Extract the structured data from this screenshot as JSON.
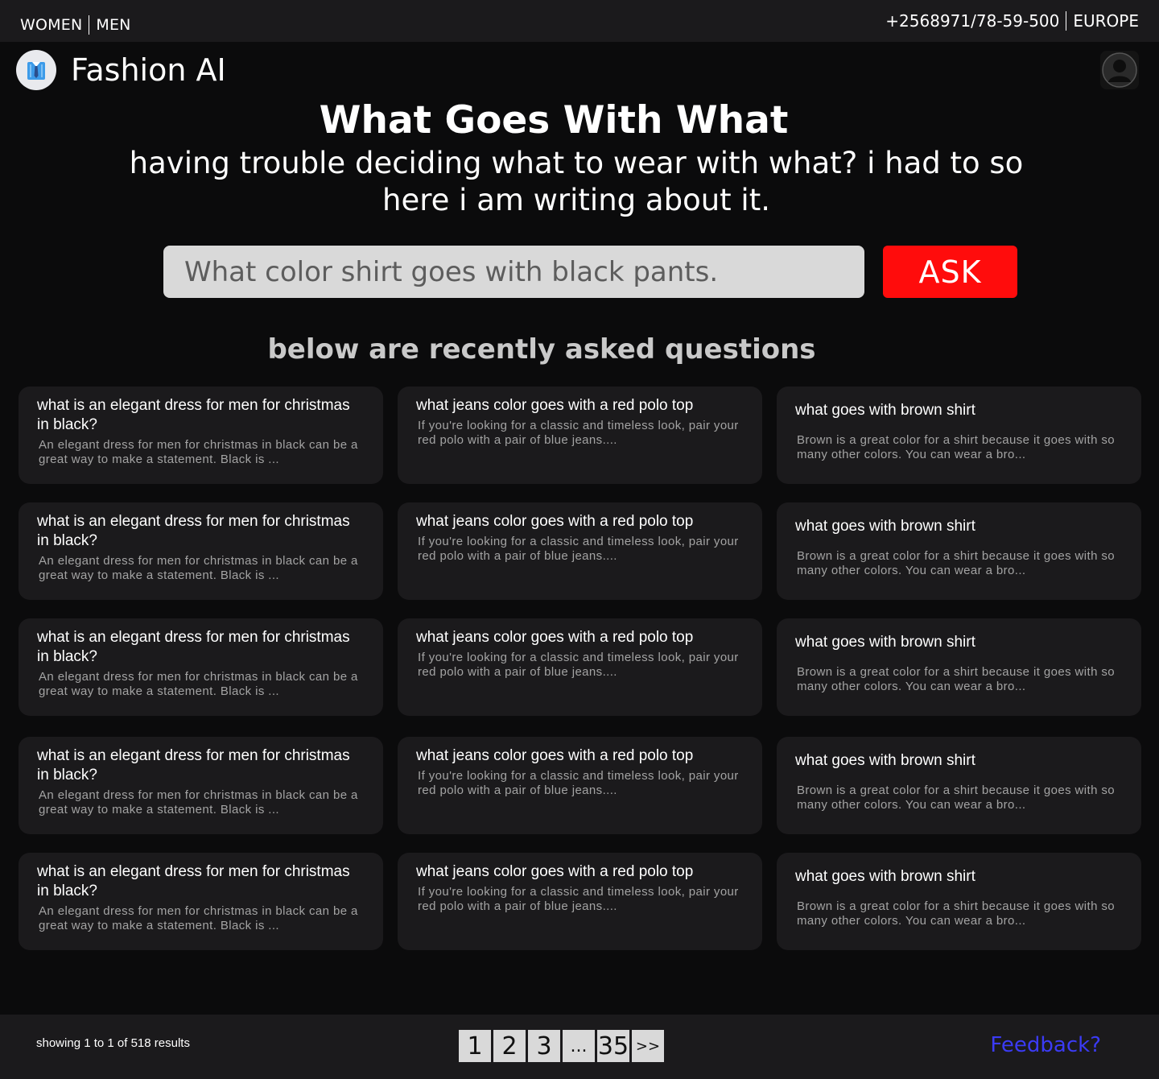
{
  "topbar": {
    "women": "WOMEN",
    "men": "MEN",
    "phone": "+2568971/78-59-500",
    "region": "EUROPE"
  },
  "header": {
    "brand": "Fashion AI",
    "logo_icon": "shirt-tie-icon",
    "profile_icon": "user-silhouette-icon"
  },
  "hero": {
    "title": "What Goes With What",
    "subtitle": "having trouble deciding what to wear with what? i had to so here i am writing about it."
  },
  "search": {
    "placeholder": "What color shirt goes with black pants.",
    "value": "",
    "ask_label": "ASK"
  },
  "recent": {
    "heading": "below are recently asked questions",
    "rows": [
      [
        {
          "question": "what is an elegant dress for men for christmas in black?",
          "answer": "An elegant dress for men for christmas in black can be a great way to make a statement. Black is ..."
        },
        {
          "question": "what jeans color goes with a red polo top",
          "answer": "If you're looking for a classic and timeless look, pair your red polo with a pair of blue jeans...."
        },
        {
          "question": "what goes with brown shirt",
          "answer": "Brown is a great color for a shirt because it goes with so many other colors. You can wear a bro..."
        }
      ],
      [
        {
          "question": "what is an elegant dress for men for christmas in black?",
          "answer": "An elegant dress for men for christmas in black can be a great way to make a statement. Black is ..."
        },
        {
          "question": "what jeans color goes with a red polo top",
          "answer": "If you're looking for a classic and timeless look, pair your red polo with a pair of blue jeans...."
        },
        {
          "question": "what goes with brown shirt",
          "answer": "Brown is a great color for a shirt because it goes with so many other colors. You can wear a bro..."
        }
      ],
      [
        {
          "question": "what is an elegant dress for men for christmas in black?",
          "answer": "An elegant dress for men for christmas in black can be a great way to make a statement. Black is ..."
        },
        {
          "question": "what jeans color goes with a red polo top",
          "answer": "If you're looking for a classic and timeless look, pair your red polo with a pair of blue jeans...."
        },
        {
          "question": "what goes with brown shirt",
          "answer": "Brown is a great color for a shirt because it goes with so many other colors. You can wear a bro..."
        }
      ],
      [
        {
          "question": "what is an elegant dress for men for christmas in black?",
          "answer": "An elegant dress for men for christmas in black can be a great way to make a statement. Black is ..."
        },
        {
          "question": "what jeans color goes with a red polo top",
          "answer": "If you're looking for a classic and timeless look, pair your red polo with a pair of blue jeans...."
        },
        {
          "question": "what goes with brown shirt",
          "answer": "Brown is a great color for a shirt because it goes with so many other colors. You can wear a bro..."
        }
      ],
      [
        {
          "question": "what is an elegant dress for men for christmas in black?",
          "answer": "An elegant dress for men for christmas in black can be a great way to make a statement. Black is ..."
        },
        {
          "question": "what jeans color goes with a red polo top",
          "answer": "If you're looking for a classic and timeless look, pair your red polo with a pair of blue jeans...."
        },
        {
          "question": "what goes with brown shirt",
          "answer": "Brown is a great color for a shirt because it goes with so many other colors. You can wear a bro..."
        }
      ]
    ]
  },
  "footer": {
    "results_text": "showing 1 to 1 of 518 results",
    "pages": [
      "1",
      "2",
      "3",
      "...",
      "35",
      ">>"
    ],
    "feedback_label": "Feedback?"
  },
  "colors": {
    "accent_red": "#ff0c0c",
    "feedback_blue": "#3b3bf5",
    "card_bg": "#1b1a1c",
    "page_bg": "#0b0b0c"
  }
}
